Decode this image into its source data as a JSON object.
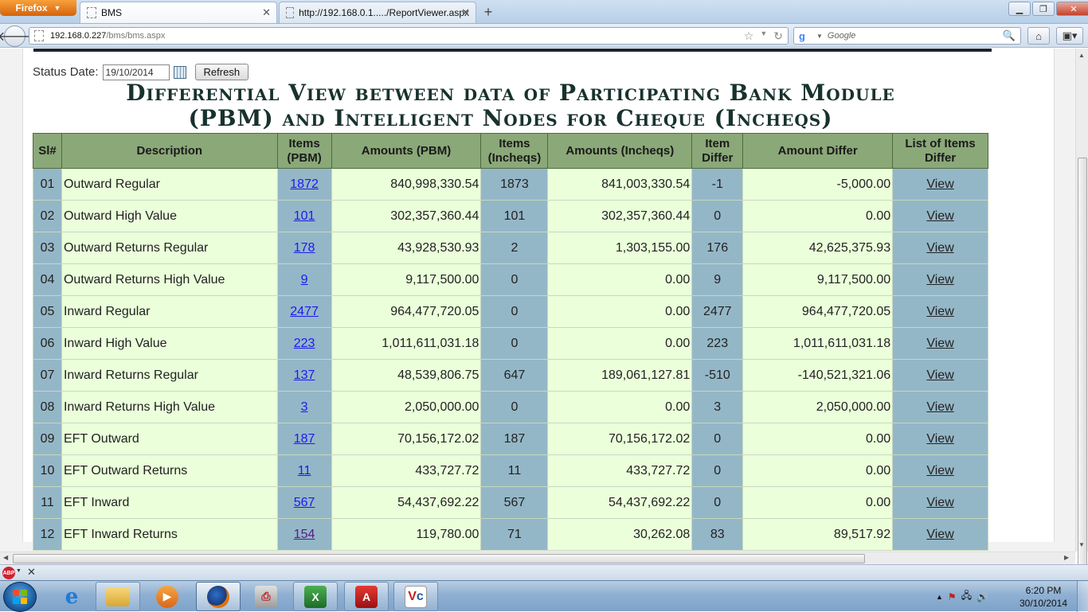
{
  "browser": {
    "menu_label": "Firefox",
    "tabs": [
      {
        "title": "BMS",
        "active": true
      },
      {
        "title": "http://192.168.0.1...../ReportViewer.aspx",
        "active": false
      }
    ],
    "url_host": "192.168.0.227",
    "url_path": "/bms/bms.aspx",
    "search_placeholder": "Google"
  },
  "page": {
    "status_label": "Status Date:",
    "status_date": "19/10/2014",
    "refresh_label": "Refresh",
    "title_line1": "Differential View between data of Participating Bank Module",
    "title_line2": "(PBM) and Intelligent Nodes for Cheque (Incheqs)"
  },
  "table": {
    "headers": {
      "sl": "Sl#",
      "description": "Description",
      "items_pbm_1": "Items",
      "items_pbm_2": "(PBM)",
      "amounts_pbm": "Amounts (PBM)",
      "items_incheqs_1": "Items",
      "items_incheqs_2": "(Incheqs)",
      "amounts_incheqs": "Amounts (Incheqs)",
      "item_differ_1": "Item",
      "item_differ_2": "Differ",
      "amount_differ": "Amount Differ",
      "list_items_1": "List of Items",
      "list_items_2": "Differ"
    },
    "rows": [
      {
        "sl": "01",
        "desc": "Outward Regular",
        "items_pbm": "1872",
        "amt_pbm": "840,998,330.54",
        "items_inc": "1873",
        "amt_inc": "841,003,330.54",
        "item_diff": "-1",
        "amt_diff": "-5,000.00",
        "view": "View",
        "visited": false
      },
      {
        "sl": "02",
        "desc": "Outward High Value",
        "items_pbm": "101",
        "amt_pbm": "302,357,360.44",
        "items_inc": "101",
        "amt_inc": "302,357,360.44",
        "item_diff": "0",
        "amt_diff": "0.00",
        "view": "View",
        "visited": false
      },
      {
        "sl": "03",
        "desc": "Outward Returns Regular",
        "items_pbm": "178",
        "amt_pbm": "43,928,530.93",
        "items_inc": "2",
        "amt_inc": "1,303,155.00",
        "item_diff": "176",
        "amt_diff": "42,625,375.93",
        "view": "View",
        "visited": false
      },
      {
        "sl": "04",
        "desc": "Outward Returns High Value",
        "items_pbm": "9",
        "amt_pbm": "9,117,500.00",
        "items_inc": "0",
        "amt_inc": "0.00",
        "item_diff": "9",
        "amt_diff": "9,117,500.00",
        "view": "View",
        "visited": false
      },
      {
        "sl": "05",
        "desc": "Inward Regular",
        "items_pbm": "2477",
        "amt_pbm": "964,477,720.05",
        "items_inc": "0",
        "amt_inc": "0.00",
        "item_diff": "2477",
        "amt_diff": "964,477,720.05",
        "view": "View",
        "visited": false
      },
      {
        "sl": "06",
        "desc": "Inward High Value",
        "items_pbm": "223",
        "amt_pbm": "1,011,611,031.18",
        "items_inc": "0",
        "amt_inc": "0.00",
        "item_diff": "223",
        "amt_diff": "1,011,611,031.18",
        "view": "View",
        "visited": false
      },
      {
        "sl": "07",
        "desc": "Inward Returns Regular",
        "items_pbm": "137",
        "amt_pbm": "48,539,806.75",
        "items_inc": "647",
        "amt_inc": "189,061,127.81",
        "item_diff": "-510",
        "amt_diff": "-140,521,321.06",
        "view": "View",
        "visited": false
      },
      {
        "sl": "08",
        "desc": "Inward Returns High Value",
        "items_pbm": "3",
        "amt_pbm": "2,050,000.00",
        "items_inc": "0",
        "amt_inc": "0.00",
        "item_diff": "3",
        "amt_diff": "2,050,000.00",
        "view": "View",
        "visited": false
      },
      {
        "sl": "09",
        "desc": "EFT Outward",
        "items_pbm": "187",
        "amt_pbm": "70,156,172.02",
        "items_inc": "187",
        "amt_inc": "70,156,172.02",
        "item_diff": "0",
        "amt_diff": "0.00",
        "view": "View",
        "visited": false
      },
      {
        "sl": "10",
        "desc": "EFT Outward Returns",
        "items_pbm": "11",
        "amt_pbm": "433,727.72",
        "items_inc": "11",
        "amt_inc": "433,727.72",
        "item_diff": "0",
        "amt_diff": "0.00",
        "view": "View",
        "visited": false
      },
      {
        "sl": "11",
        "desc": "EFT Inward",
        "items_pbm": "567",
        "amt_pbm": "54,437,692.22",
        "items_inc": "567",
        "amt_inc": "54,437,692.22",
        "item_diff": "0",
        "amt_diff": "0.00",
        "view": "View",
        "visited": false
      },
      {
        "sl": "12",
        "desc": "EFT Inward Returns",
        "items_pbm": "154",
        "amt_pbm": "119,780.00",
        "items_inc": "71",
        "amt_inc": "30,262.08",
        "item_diff": "83",
        "amt_diff": "89,517.92",
        "view": "View",
        "visited": true
      }
    ]
  },
  "addon_bar": {
    "abp_label": "ABP"
  },
  "taskbar": {
    "apps": [
      "internet-explorer",
      "file-explorer",
      "media-player",
      "firefox",
      "printer-settings",
      "excel",
      "acrobat-reader",
      "visio"
    ],
    "time": "6:20 PM",
    "date": "30/10/2014"
  },
  "colors": {
    "header_bg": "#8aa878",
    "blue_cell": "#94b7c7",
    "green_cell": "#eaffda",
    "title_color": "#18322e"
  }
}
